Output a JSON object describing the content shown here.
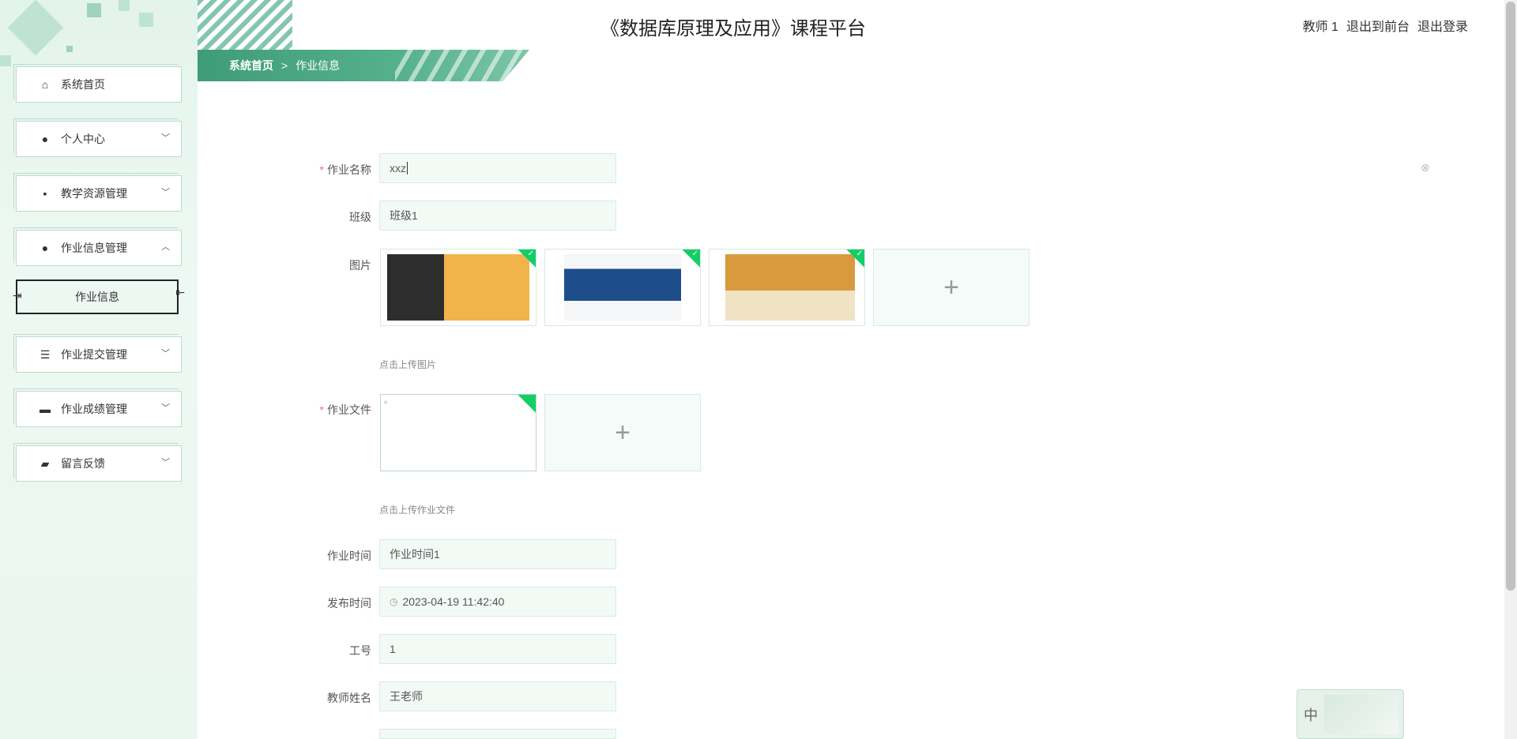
{
  "header": {
    "title": "《数据库原理及应用》课程平台",
    "user": "教师 1",
    "front_link": "退出到前台",
    "logout_link": "退出登录"
  },
  "breadcrumb": {
    "home": "系统首页",
    "separator": ">",
    "current": "作业信息"
  },
  "sidebar": {
    "items": [
      {
        "label": "系统首页",
        "icon": "home-icon"
      },
      {
        "label": "个人中心",
        "icon": "user-icon"
      },
      {
        "label": "教学资源管理",
        "icon": "message-icon"
      },
      {
        "label": "作业信息管理",
        "icon": "user-icon"
      },
      {
        "label": "作业提交管理",
        "icon": "list-icon"
      },
      {
        "label": "作业成绩管理",
        "icon": "monitor-icon"
      },
      {
        "label": "留言反馈",
        "icon": "wallet-icon"
      }
    ],
    "sub_item": "作业信息"
  },
  "form": {
    "name_label": "作业名称",
    "name_value": "xxz",
    "class_label": "班级",
    "class_value": "班级1",
    "image_label": "图片",
    "image_tip": "点击上传图片",
    "file_label": "作业文件",
    "file_tip": "点击上传作业文件",
    "time_label": "作业时间",
    "time_value": "作业时间1",
    "publish_label": "发布时间",
    "publish_value": "2023-04-19 11:42:40",
    "worknum_label": "工号",
    "worknum_value": "1",
    "teacher_label": "教师姓名",
    "teacher_value": "王老师"
  },
  "ime": {
    "mode": "中"
  },
  "colors": {
    "accent": "#4fae8a",
    "required": "#f56c6c",
    "check": "#13ce66"
  }
}
